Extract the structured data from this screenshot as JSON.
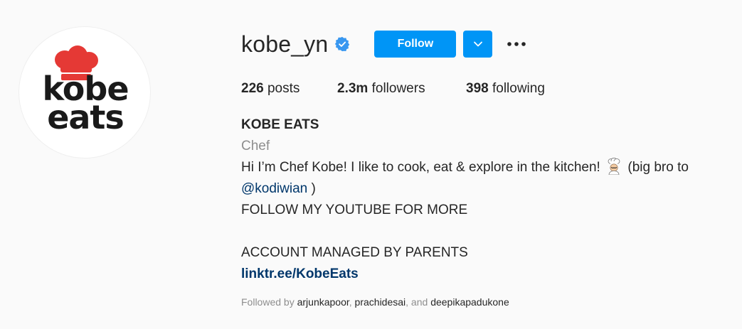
{
  "profile": {
    "avatar_alt": "kobe eats logo",
    "logo_line1": "kobe",
    "logo_line2": "eats",
    "username": "kobe_yn",
    "verified_icon": "verified-badge",
    "follow_label": "Follow",
    "dropdown_icon": "chevron-down",
    "more_icon": "more-horizontal",
    "accent_color": "#0095f6"
  },
  "stats": {
    "posts_count": "226",
    "posts_label": "posts",
    "followers_count": "2.3m",
    "followers_label": "followers",
    "following_count": "398",
    "following_label": "following"
  },
  "bio": {
    "display_name": "KOBE EATS",
    "category": "Chef",
    "line1_text": "Hi I’m Chef Kobe! I like to cook, eat & explore in the kitchen!",
    "line1_after": "(big bro to",
    "mention": "@kodiwian",
    "mention_after": ")",
    "line3": "FOLLOW MY YOUTUBE FOR MORE",
    "line5": "ACCOUNT MANAGED BY PARENTS",
    "link": "linktr.ee/KobeEats"
  },
  "followed_by": {
    "prefix": "Followed by",
    "account1": "arjunkapoor",
    "sep1": ",",
    "account2": "prachidesai",
    "sep2": ", and",
    "account3": "deepikapadukone"
  }
}
